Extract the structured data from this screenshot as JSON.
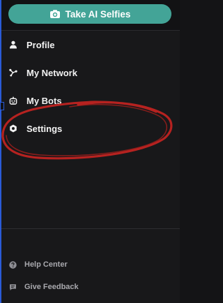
{
  "header": {
    "cta_label": "Take AI Selfies",
    "cta_icon": "camera-plus-icon"
  },
  "menu": {
    "items": [
      {
        "label": "Profile",
        "icon": "person-icon"
      },
      {
        "label": "My Network",
        "icon": "network-icon"
      },
      {
        "label": "My Bots",
        "icon": "robot-icon"
      },
      {
        "label": "Settings",
        "icon": "hexagon-gear-icon"
      }
    ]
  },
  "footer": {
    "items": [
      {
        "label": "Help Center",
        "icon": "help-circle-icon"
      },
      {
        "label": "Give Feedback",
        "icon": "chat-bubble-icon"
      }
    ]
  },
  "colors": {
    "accent": "#43a497",
    "background": "#18181a",
    "annotation": "#c42421"
  }
}
